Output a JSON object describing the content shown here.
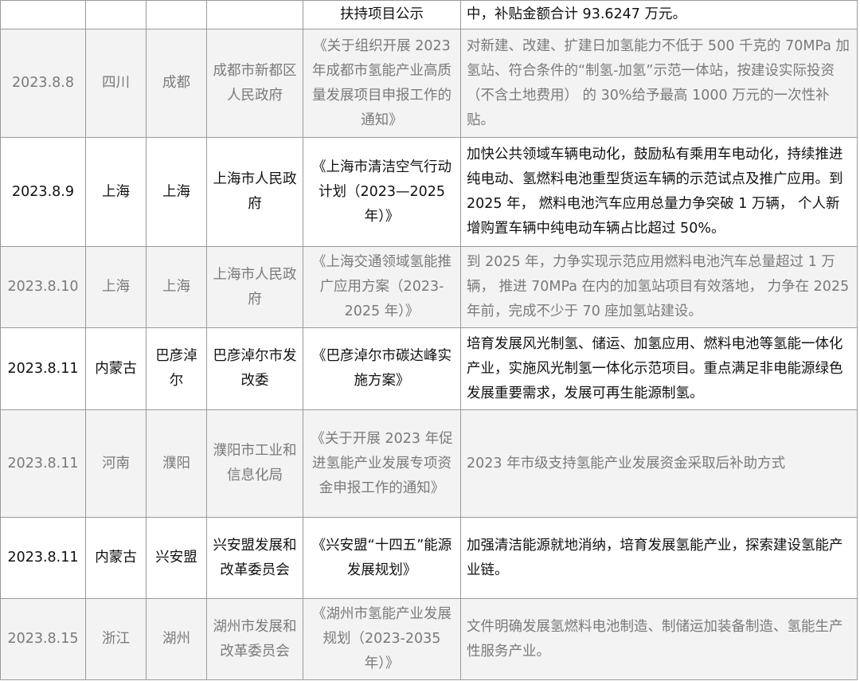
{
  "top_row": {
    "date": "",
    "province": "",
    "city": "",
    "department": "",
    "title": "扶持项目公示",
    "content": "中，补贴金额合计 93.6247 万元。"
  },
  "rows": [
    {
      "date": "2023.8.8",
      "province": "四川",
      "city": "成都",
      "department": "成都市新都区人民政府",
      "title": "《关于组织开展 2023 年成都市氢能产业高质量发展项目申报工作的通知》",
      "content": "对新建、改建、扩建日加氢能力不低于 500 千克的 70MPa 加氢站、符合条件的“制氢-加氢”示范一体站，按建设实际投资（不含土地费用） 的 30%给予最高 1000 万元的一次性补贴。"
    },
    {
      "date": "2023.8.9",
      "province": "上海",
      "city": "上海",
      "department": "上海市人民政府",
      "title": "《上海市清洁空气行动计划（2023—2025 年）》",
      "content": "加快公共领域车辆电动化，鼓励私有乘用车电动化，持续推进纯电动、氢燃料电池重型货运车辆的示范试点及推广应用。到 2025 年， 燃料电池汽车应用总量力争突破 1 万辆， 个人新增购置车辆中纯电动车辆占比超过 50%。"
    },
    {
      "date": "2023.8.10",
      "province": "上海",
      "city": "上海",
      "department": "上海市人民政府",
      "title": "《上海交通领域氢能推广应用方案（2023-2025 年）》",
      "content": "到 2025 年，力争实现示范应用燃料电池汽车总量超过 1 万辆， 推进 70MPa 在内的加氢站项目有效落地， 力争在 2025 年前，完成不少于 70 座加氢站建设。"
    },
    {
      "date": "2023.8.11",
      "province": "内蒙古",
      "city": "巴彦淖尔",
      "department": "巴彦淖尔市发改委",
      "title": "《巴彦淖尔市碳达峰实施方案》",
      "content": "培育发展风光制氢、储运、加氢应用、燃料电池等氢能一体化产业，实施风光制氢一体化示范项目。重点满足非电能源绿色发展重要需求，发展可再生能源制氢。"
    },
    {
      "date": "2023.8.11",
      "province": "河南",
      "city": "濮阳",
      "department": "濮阳市工业和信息化局",
      "title": "《关于开展 2023 年促进氢能产业发展专项资金申报工作的通知》",
      "content": "2023 年市级支持氢能产业发展资金采取后补助方式"
    },
    {
      "date": "2023.8.11",
      "province": "内蒙古",
      "city": "兴安盟",
      "department": "兴安盟发展和改革委员会",
      "title": "《兴安盟“十四五”能源发展规划》",
      "content": "加强清洁能源就地消纳，培育发展氢能产业，探索建设氢能产业链。"
    },
    {
      "date": "2023.8.15",
      "province": "浙江",
      "city": "湖州",
      "department": "湖州市发展和改革委员会",
      "title": "《湖州市氢能产业发展规划（2023-2035 年）》",
      "content": "文件明确发展氢燃料电池制造、制储运加装备制造、氢能生产性服务产业。"
    }
  ]
}
